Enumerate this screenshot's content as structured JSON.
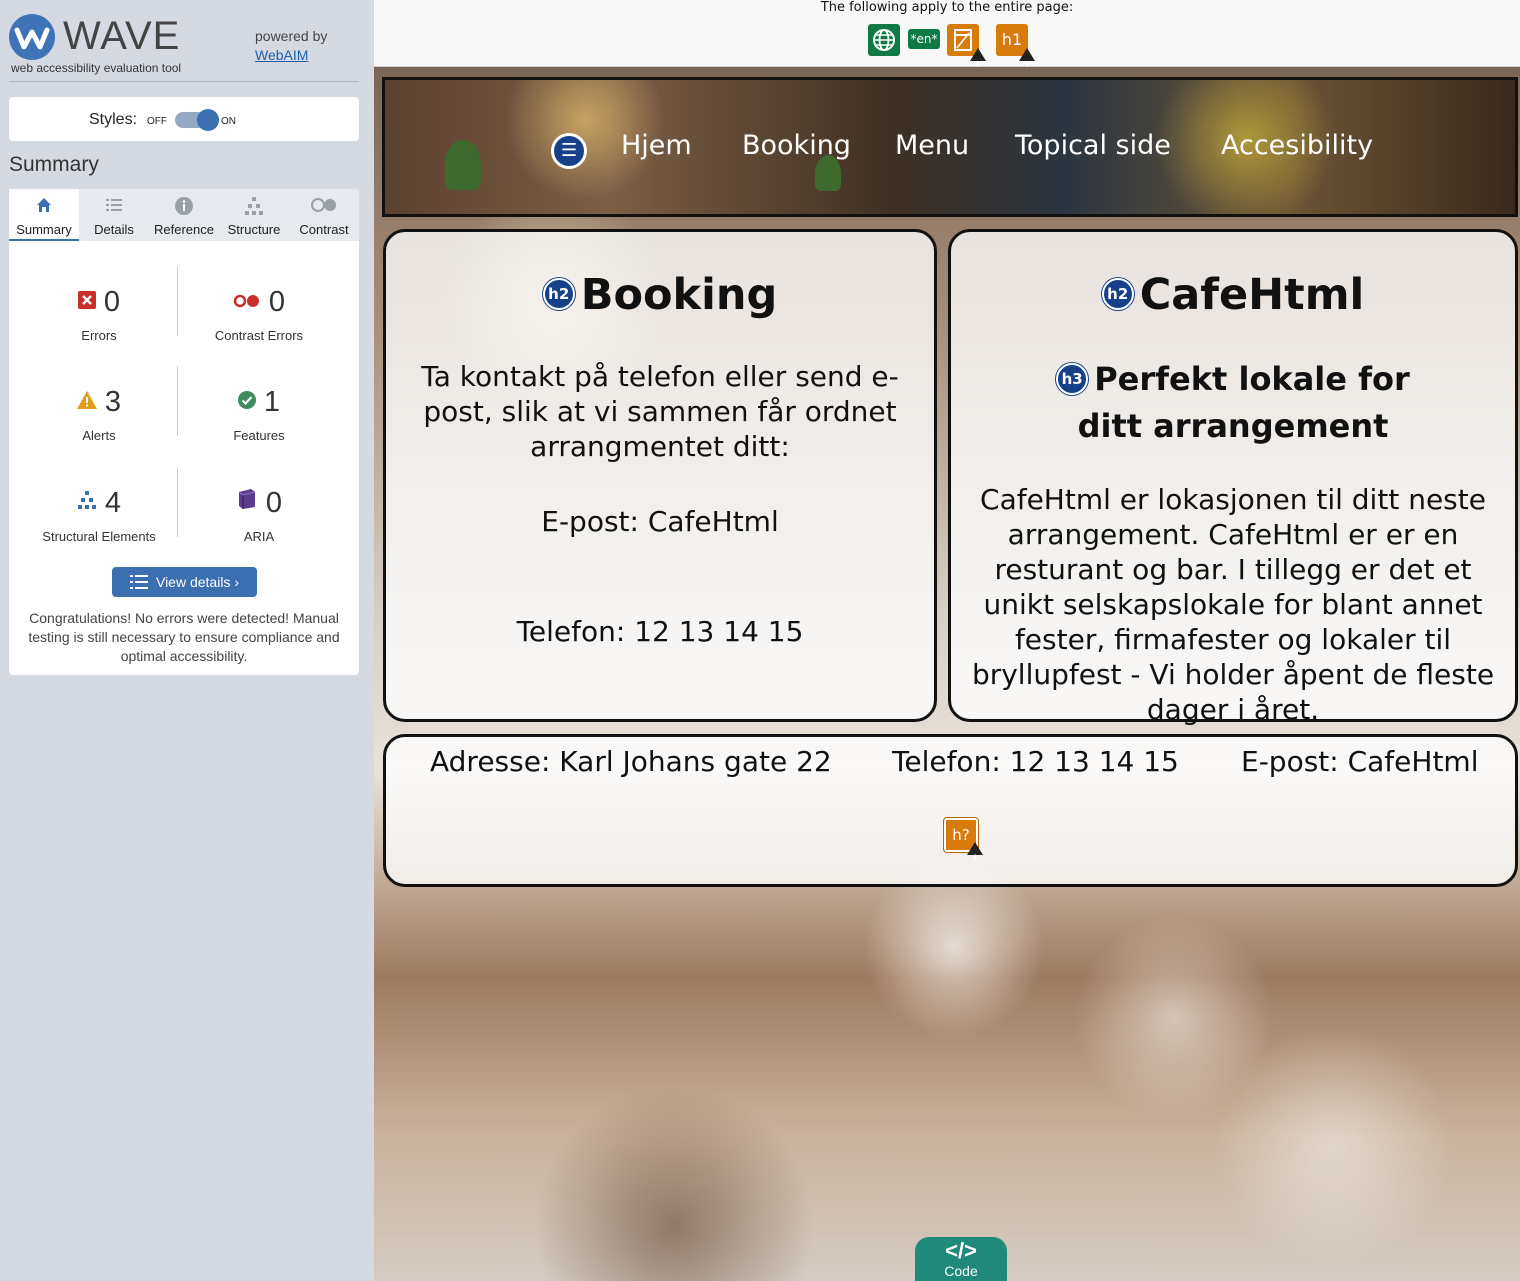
{
  "wave": {
    "title": "WAVE",
    "subtitle": "web accessibility evaluation tool",
    "powered_by": "powered by",
    "webaim_link": "WebAIM",
    "styles_label": "Styles:",
    "toggle_off": "OFF",
    "toggle_on": "ON",
    "summary_heading": "Summary",
    "tabs": [
      {
        "label": "Summary",
        "icon": "home-icon"
      },
      {
        "label": "Details",
        "icon": "list-icon"
      },
      {
        "label": "Reference",
        "icon": "info-icon"
      },
      {
        "label": "Structure",
        "icon": "structure-icon"
      },
      {
        "label": "Contrast",
        "icon": "contrast-icon"
      }
    ],
    "stats": {
      "errors": {
        "count": "0",
        "label": "Errors"
      },
      "contrast_errors": {
        "count": "0",
        "label": "Contrast Errors"
      },
      "alerts": {
        "count": "3",
        "label": "Alerts"
      },
      "features": {
        "count": "1",
        "label": "Features"
      },
      "structural": {
        "count": "4",
        "label": "Structural Elements"
      },
      "aria": {
        "count": "0",
        "label": "ARIA"
      }
    },
    "view_details": "View details ›",
    "congrats": "Congratulations! No errors were detected! Manual testing is still necessary to ensure compliance and optimal accessibility.",
    "colors": {
      "accent": "#3c6fb0",
      "error": "#c9302c",
      "alert": "#e39b1e",
      "feature": "#3f8b5c",
      "aria": "#5a3b8c"
    }
  },
  "page": {
    "apply_text": "The following apply to the entire page:",
    "page_icons": [
      {
        "icon": "language-globe-icon",
        "color": "#0f7a46"
      },
      {
        "icon": "lang-attribute-icon",
        "text": "*en*",
        "color": "#0f7a46"
      },
      {
        "icon": "page-title-alert-icon",
        "color": "#d87a0c"
      },
      {
        "icon": "missing-h1-alert-icon",
        "text": "h1",
        "color": "#d87a0c"
      }
    ],
    "nav": [
      "Hjem",
      "Booking",
      "Menu",
      "Topical side",
      "Accesibility"
    ],
    "booking": {
      "badge": "h2",
      "heading": "Booking",
      "text": "Ta kontakt på telefon eller send e-post, slik at vi sammen får ordnet arrangmentet ditt:",
      "email": "E-post: CafeHtml",
      "phone": "Telefon: 12 13 14 15"
    },
    "cafe": {
      "badge": "h2",
      "heading": "CafeHtml",
      "sub_badge": "h3",
      "subheading": "Perfekt lokale for ditt arrangement",
      "text": "CafeHtml er lokasjonen til ditt neste arrangement. CafeHtml er er en resturant og bar. I tillegg er det et unikt selskapslokale for blant annet fester, firmafester og lokaler til bryllupfest - Vi holder åpent de fleste dager i året."
    },
    "footer": {
      "address": "Adresse: Karl Johans gate 22",
      "phone": "Telefon: 12 13 14 15",
      "email": "E-post: CafeHtml",
      "alert_badge": "h?"
    },
    "code_button": {
      "label": "Code",
      "icon": "</>"
    }
  }
}
